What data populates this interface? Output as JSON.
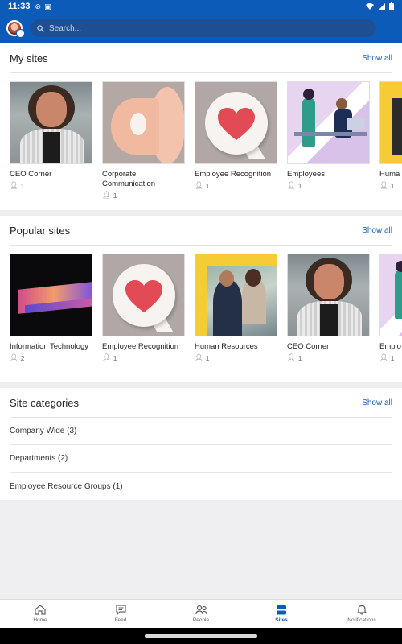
{
  "status_bar": {
    "time": "11:33"
  },
  "search": {
    "placeholder": "Search..."
  },
  "my_sites": {
    "title": "My sites",
    "show_all": "Show all",
    "tiles": [
      {
        "name": "CEO Corner",
        "members": "1"
      },
      {
        "name": "Corporate Communication",
        "members": "1"
      },
      {
        "name": "Employee Recognition",
        "members": "1"
      },
      {
        "name": "Employees",
        "members": "1"
      },
      {
        "name": "Huma",
        "members": "1"
      }
    ]
  },
  "popular_sites": {
    "title": "Popular sites",
    "show_all": "Show all",
    "tiles": [
      {
        "name": "Information Technology",
        "members": "2"
      },
      {
        "name": "Employee Recognition",
        "members": "1"
      },
      {
        "name": "Human Resources",
        "members": "1"
      },
      {
        "name": "CEO Corner",
        "members": "1"
      },
      {
        "name": "Emplo",
        "members": "1"
      }
    ]
  },
  "site_categories": {
    "title": "Site categories",
    "show_all": "Show all",
    "items": [
      "Company Wide (3)",
      "Departments (2)",
      "Employee Resource Groups (1)"
    ]
  },
  "bottom_nav": {
    "items": [
      {
        "label": "Home",
        "icon": "home-icon"
      },
      {
        "label": "Feed",
        "icon": "feed-icon"
      },
      {
        "label": "People",
        "icon": "people-icon"
      },
      {
        "label": "Sites",
        "icon": "sites-icon"
      },
      {
        "label": "Notifications",
        "icon": "bell-icon"
      }
    ],
    "active": "Sites"
  },
  "colors": {
    "brand": "#0c5bb8",
    "link": "#1b5fb5",
    "heart": "#e24a55"
  }
}
